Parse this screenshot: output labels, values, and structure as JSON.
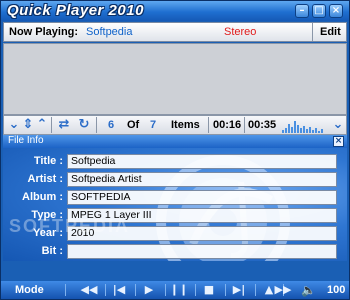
{
  "window": {
    "title": "Quick Player 2010",
    "controls": [
      "minimize-icon",
      "maximize-icon",
      "close-icon"
    ]
  },
  "now_playing": {
    "label": "Now Playing:",
    "track": "Softpedia",
    "channel": "Stereo",
    "edit_label": "Edit"
  },
  "controls": {
    "current": "6",
    "of_label": "Of",
    "total": "7",
    "items_label": "Items",
    "elapsed": "00:16",
    "duration": "00:35",
    "icons": [
      "sort-down-icon",
      "sort-updown-icon",
      "move-up-icon",
      "shuffle-icon",
      "repeat-icon",
      "collapse-icon"
    ]
  },
  "file_info": {
    "title": "File Info",
    "fields": [
      {
        "label": "Title :",
        "value": "Softpedia"
      },
      {
        "label": "Artist :",
        "value": "Softpedia Artist"
      },
      {
        "label": "Album :",
        "value": "SOFTPEDIA"
      },
      {
        "label": "Type :",
        "value": "MPEG 1 Layer III"
      },
      {
        "label": "Year :",
        "value": "2010"
      },
      {
        "label": "Bit :",
        "value": ""
      }
    ],
    "watermark": "SOFTPEDIA"
  },
  "bottom_bar": {
    "mode_label": "Mode",
    "buttons": [
      "rewind-icon",
      "previous-icon",
      "play-icon",
      "pause-icon",
      "stop-icon",
      "next-icon",
      "eject-icon",
      "fast-forward-icon"
    ],
    "volume": "100"
  },
  "colors": {
    "accent": "#2a6cc8",
    "stereo": "#e01b1b",
    "track": "#0f62c9",
    "panel": "#1a5fb4"
  }
}
